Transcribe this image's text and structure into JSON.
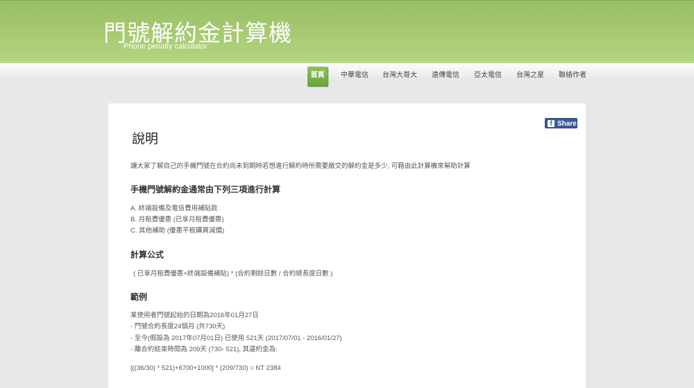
{
  "header": {
    "title": "門號解約金計算機",
    "subtitle": "Phone penalty calculator"
  },
  "nav": [
    "首頁",
    "中華電信",
    "台灣大哥大",
    "遠傳電信",
    "亞太電信",
    "台灣之星",
    "聯絡作者"
  ],
  "share_label": "Share",
  "content": {
    "title": "說明",
    "intro": "讓大家了解自己的手機門號在合約尚未到期時若想進行解約時所需要繳交的解約金是多少, 可藉由此計算機來幫助計算",
    "h1": "手機門號解約金通常由下列三項進行計算",
    "items": [
      "A. 終端設備及電信費用補貼款",
      "B. 月租費優惠 (已享月租費優惠)",
      "C. 其他補助 (優惠平板購買減價)"
    ],
    "h2": "計算公式",
    "formula": "( 已享月租費優惠+終端設備補貼) * (合約剩餘日數 / 合約總長度日數 )",
    "h3": "範例",
    "example": [
      "某使用者門號起始的日期為2016年01月27日",
      "- 門號合約長度24個月 (共730天)",
      "- 至今(假設為 2017年07月01日) 已使用 521天 (2017/07/01 - 2016/01/27)",
      "- 離合約結束時間為 209天 (730- 521), 其違約金為:"
    ],
    "result": "[((36/30) * 521)+6700+1000] * (209/730) = NT 2384"
  }
}
